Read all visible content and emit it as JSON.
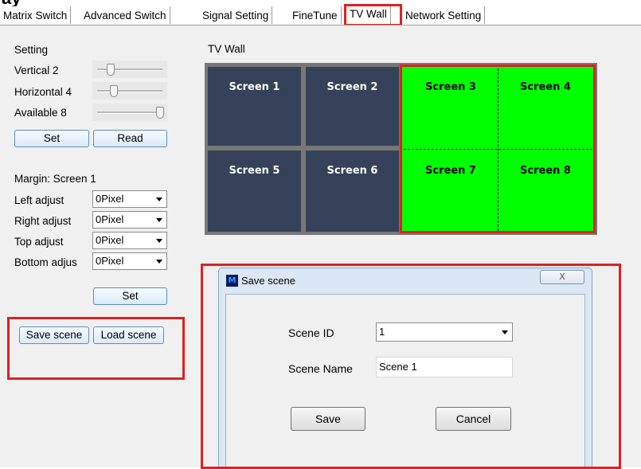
{
  "heading_fragment": "ay sequence",
  "tabs": [
    {
      "label": "Matrix Switch"
    },
    {
      "label": "Advanced Switch"
    },
    {
      "label": "Signal Setting"
    },
    {
      "label": "FineTune"
    },
    {
      "label": "TV Wall",
      "active": true
    },
    {
      "label": "Network Setting"
    }
  ],
  "setting": {
    "title": "Setting",
    "vertical": {
      "label": "Vertical 2",
      "value": 2
    },
    "horizontal": {
      "label": "Horizontal 4",
      "value": 4
    },
    "available": {
      "label": "Available 8",
      "value": 8
    },
    "set_label": "Set",
    "read_label": "Read"
  },
  "margin": {
    "title": "Margin: Screen 1",
    "rows": [
      {
        "label": "Left adjust",
        "value": "0Pixel"
      },
      {
        "label": "Right adjust",
        "value": "0Pixel"
      },
      {
        "label": "Top adjust",
        "value": "0Pixel"
      },
      {
        "label": "Bottom adjus",
        "value": "0Pixel"
      }
    ],
    "set_label": "Set"
  },
  "scene_buttons": {
    "save_label": "Save scene",
    "load_label": "Load scene"
  },
  "tvwall": {
    "title": "TV Wall",
    "screens": [
      "Screen 1",
      "Screen 2",
      "Screen 3",
      "Screen 4",
      "Screen 5",
      "Screen 6",
      "Screen 7",
      "Screen 8"
    ],
    "selected_color": "#00ff00",
    "screen_color": "#354259"
  },
  "dialog": {
    "title": "Save scene",
    "icon_text": "M",
    "close_glyph": "X",
    "scene_id_label": "Scene ID",
    "scene_id_value": "1",
    "scene_name_label": "Scene Name",
    "scene_name_value": "Scene 1",
    "save_label": "Save",
    "cancel_label": "Cancel"
  },
  "highlight_color": "#e02020"
}
